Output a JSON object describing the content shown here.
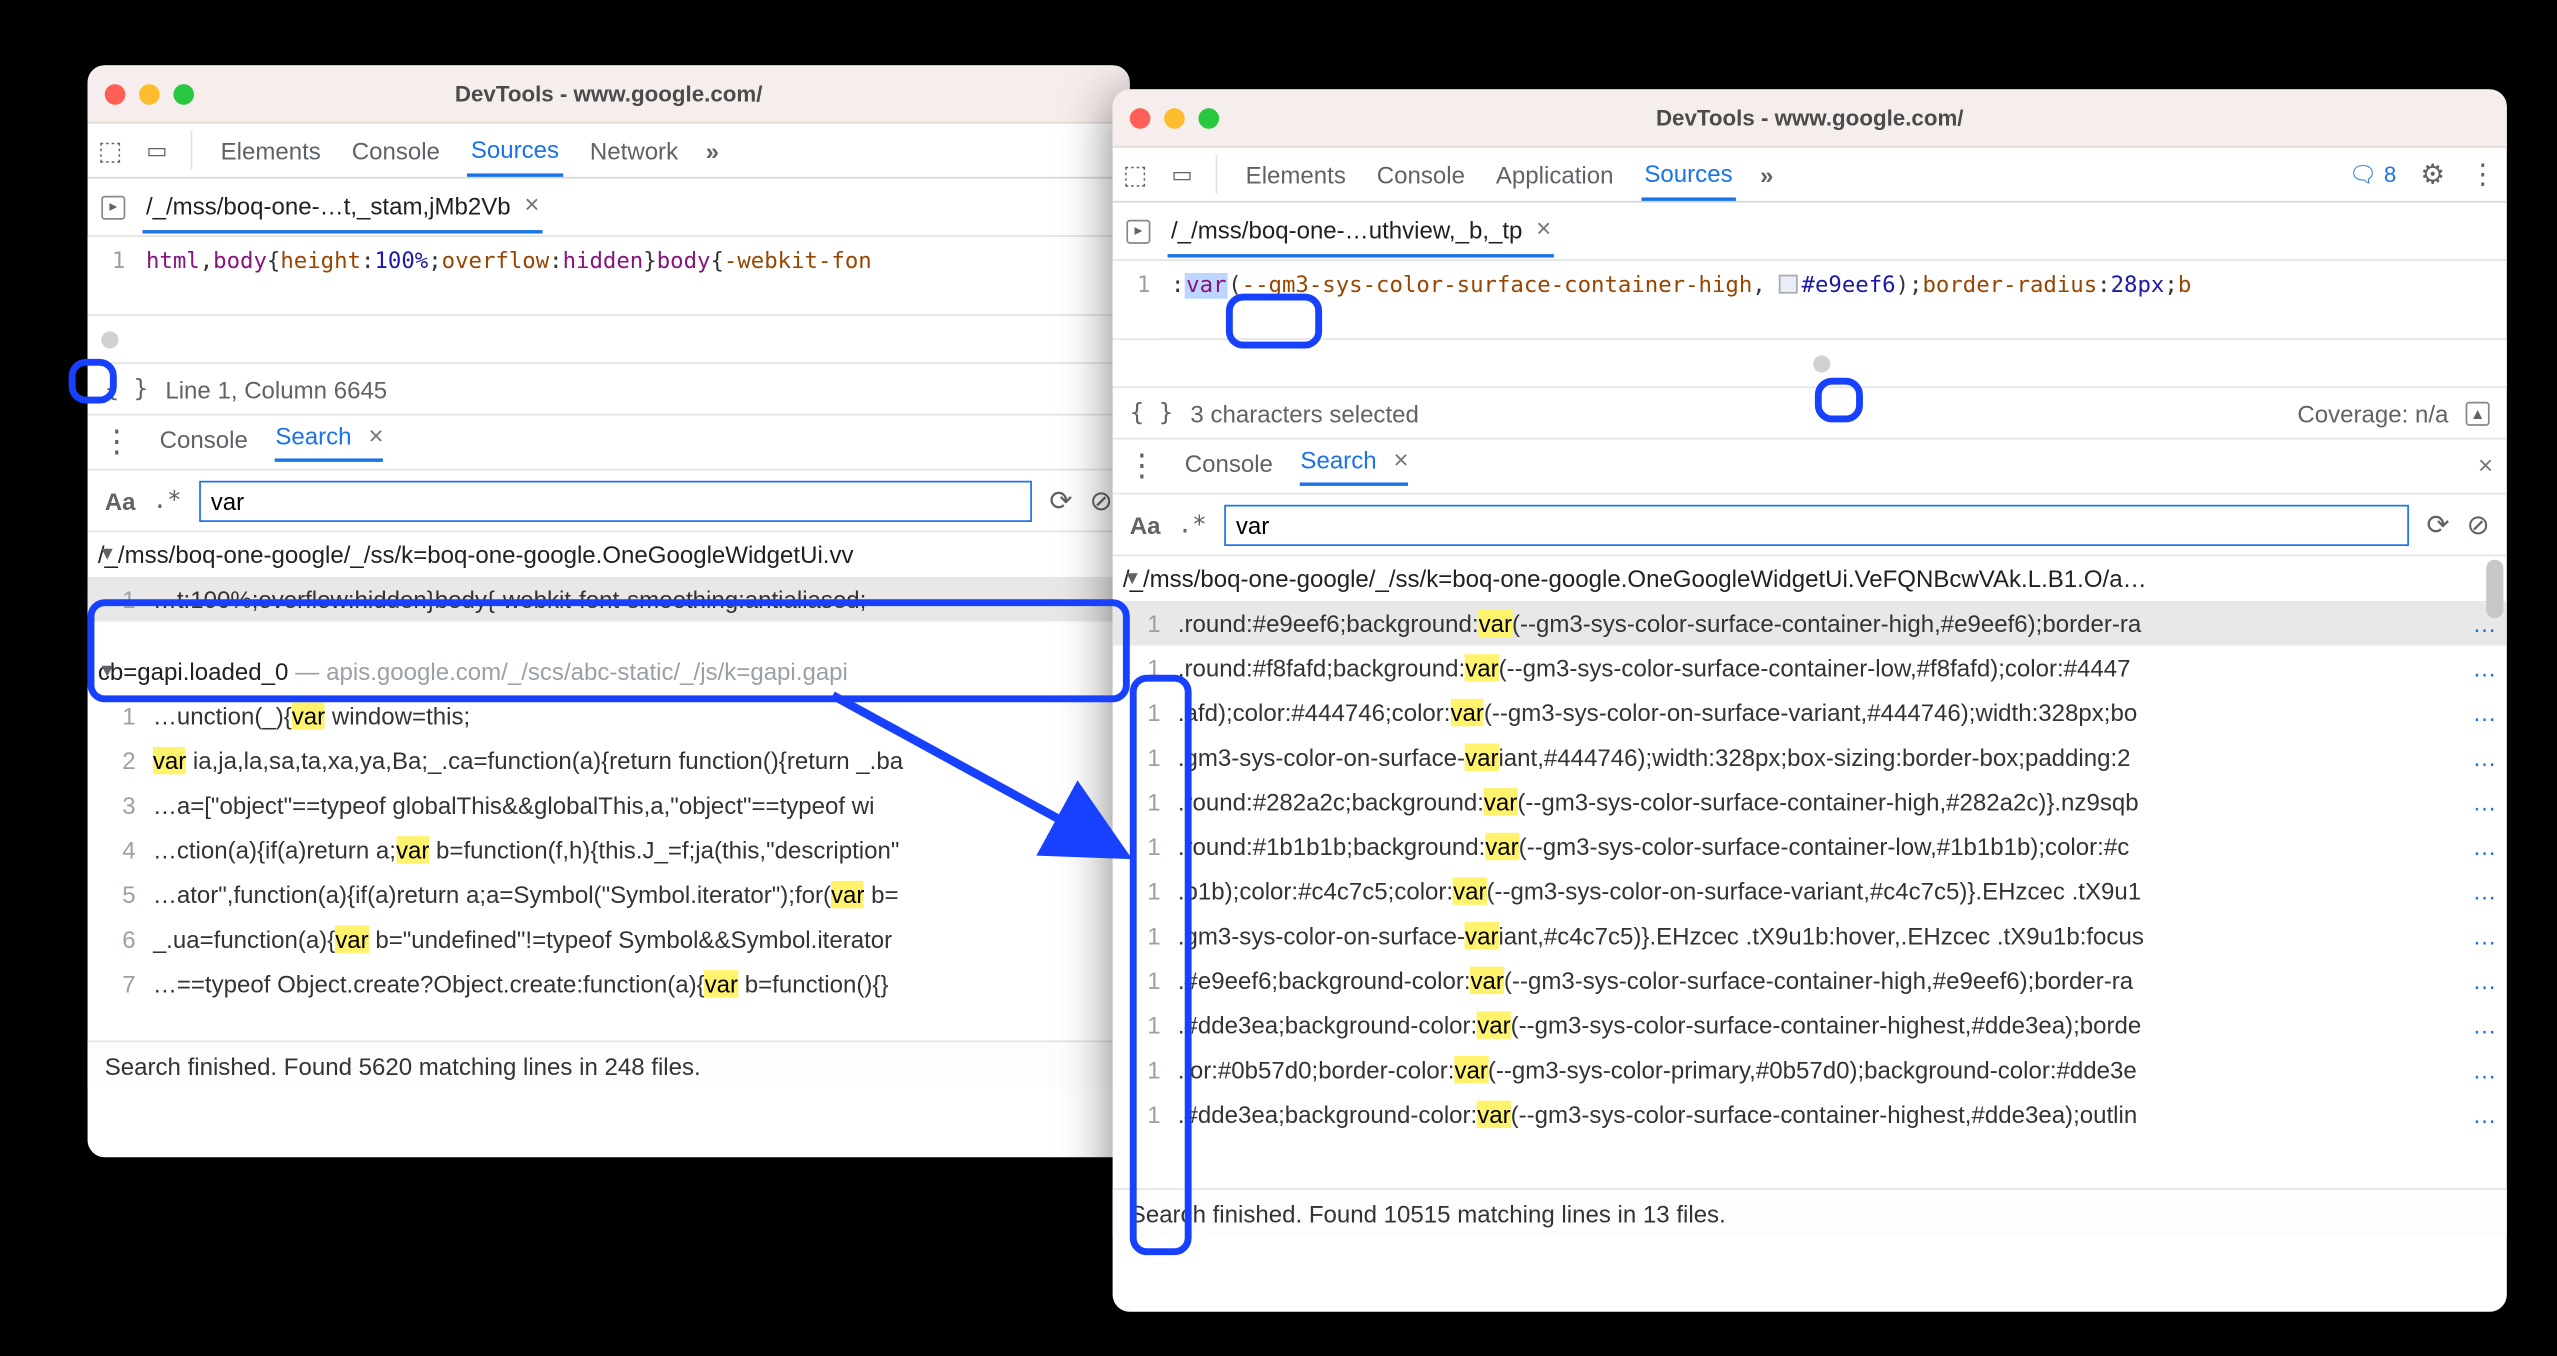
{
  "left": {
    "title": "DevTools - www.google.com/",
    "tabs": {
      "elements": "Elements",
      "console": "Console",
      "sources": "Sources",
      "network": "Network"
    },
    "file_tab": "/_/mss/boq-one-…t,_stam,jMb2Vb",
    "code": {
      "linenum": "1",
      "seg_tag1": "html",
      "seg_comma": ",",
      "seg_tag2": "body",
      "seg_brace1": "{",
      "seg_prop1": "height",
      "seg_colon1": ":",
      "seg_val1": "100%",
      "seg_semi1": ";",
      "seg_prop2": "overflow",
      "seg_colon2": ":",
      "seg_val2": "hidden",
      "seg_brace2": "}",
      "seg_tag3": "body",
      "seg_brace3": "{",
      "seg_prop3": "-webkit-fon"
    },
    "status": "Line 1, Column 6645",
    "drawer": {
      "console": "Console",
      "search": "Search"
    },
    "search_value": "var",
    "results": {
      "file1": "/_/mss/boq-one-google/_/ss/k=boq-one-google.OneGoogleWidgetUi.vv",
      "file1_rows": [
        {
          "ln": "1",
          "pre": "…t:100%;overflow:hidden}body{-webkit-font-smoothing:antialiased;-",
          "mark": "",
          "post": ""
        }
      ],
      "file2_name": "cb=gapi.loaded_0",
      "file2_dash": " — ",
      "file2_path": "apis.google.com/_/scs/abc-static/_/js/k=gapi.gapi",
      "file2_rows": [
        {
          "ln": "1",
          "pre": "…unction(_){",
          "mark": "var",
          "post": " window=this;"
        },
        {
          "ln": "2",
          "pre": "",
          "mark": "var",
          "post": " ia,ja,la,sa,ta,xa,ya,Ba;_.ca=function(a){return function(){return _.ba"
        },
        {
          "ln": "3",
          "pre": "…a=[\"object\"==typeof globalThis&&globalThis,a,\"object\"==typeof wi",
          "mark": "",
          "post": ""
        },
        {
          "ln": "4",
          "pre": "…ction(a){if(a)return a;",
          "mark": "var",
          "post": " b=function(f,h){this.J_=f;ja(this,\"description\""
        },
        {
          "ln": "5",
          "pre": "…ator\",function(a){if(a)return a;a=Symbol(\"Symbol.iterator\");for(",
          "mark": "var",
          "post": " b="
        },
        {
          "ln": "6",
          "pre": "_.ua=function(a){",
          "mark": "var",
          "post": " b=\"undefined\"!=typeof Symbol&&Symbol.iterator"
        },
        {
          "ln": "7",
          "pre": "…==typeof Object.create?Object.create:function(a){",
          "mark": "var",
          "post": " b=function(){}"
        }
      ]
    },
    "footer": "Search finished.  Found 5620 matching lines in 248 files."
  },
  "right": {
    "title": "DevTools - www.google.com/",
    "tabs": {
      "elements": "Elements",
      "console": "Console",
      "application": "Application",
      "sources": "Sources"
    },
    "issues_count": "8",
    "file_tab": "/_/mss/boq-one-…uthview,_b,_tp",
    "code": {
      "linenum": "1",
      "seg_colon": ":",
      "seg_var": "var",
      "seg_open": "(",
      "seg_varname": "--gm3-sys-color-surface-container-high",
      "seg_comma": ", ",
      "seg_hex": "#e9eef6",
      "seg_close": ")",
      "seg_semi": ";",
      "seg_prop": "border-radius",
      "seg_colon2": ":",
      "seg_val": "28px",
      "seg_semi2": ";",
      "seg_trail": "b"
    },
    "status_left": "3 characters selected",
    "status_right": "Coverage: n/a",
    "drawer": {
      "console": "Console",
      "search": "Search"
    },
    "search_value": "var",
    "results": {
      "file1": "/_/mss/boq-one-google/_/ss/k=boq-one-google.OneGoogleWidgetUi.VeFQNBcwVAk.L.B1.O/a…",
      "rows": [
        {
          "pre": ".round:#e9eef6;background:",
          "mark": "var",
          "post": "(--gm3-sys-color-surface-container-high,#e9eef6);border-ra"
        },
        {
          "pre": ".round:#f8fafd;background:",
          "mark": "var",
          "post": "(--gm3-sys-color-surface-container-low,#f8fafd);color:#4447"
        },
        {
          "pre": ".afd);color:#444746;color:",
          "mark": "var",
          "post": "(--gm3-sys-color-on-surface-variant,#444746);width:328px;bo"
        },
        {
          "pre": ".gm3-sys-color-on-surface-",
          "mark": "var",
          "post": "iant,#444746);width:328px;box-sizing:border-box;padding:2"
        },
        {
          "pre": ".round:#282a2c;background:",
          "mark": "var",
          "post": "(--gm3-sys-color-surface-container-high,#282a2c)}.nz9sqb"
        },
        {
          "pre": ".round:#1b1b1b;background:",
          "mark": "var",
          "post": "(--gm3-sys-color-surface-container-low,#1b1b1b);color:#c"
        },
        {
          "pre": ".b1b);color:#c4c7c5;color:",
          "mark": "var",
          "post": "(--gm3-sys-color-on-surface-variant,#c4c7c5)}.EHzcec .tX9u1"
        },
        {
          "pre": ".gm3-sys-color-on-surface-",
          "mark": "var",
          "post": "iant,#c4c7c5)}.EHzcec .tX9u1b:hover,.EHzcec .tX9u1b:focus"
        },
        {
          "pre": ".#e9eef6;background-color:",
          "mark": "var",
          "post": "(--gm3-sys-color-surface-container-high,#e9eef6);border-ra"
        },
        {
          "pre": ".#dde3ea;background-color:",
          "mark": "var",
          "post": "(--gm3-sys-color-surface-container-highest,#dde3ea);borde"
        },
        {
          "pre": ".lor:#0b57d0;border-color:",
          "mark": "var",
          "post": "(--gm3-sys-color-primary,#0b57d0);background-color:#dde3e"
        },
        {
          "pre": ".#dde3ea;background-color:",
          "mark": "var",
          "post": "(--gm3-sys-color-surface-container-highest,#dde3ea);outlin"
        }
      ]
    },
    "footer": "Search finished.  Found 10515 matching lines in 13 files."
  }
}
